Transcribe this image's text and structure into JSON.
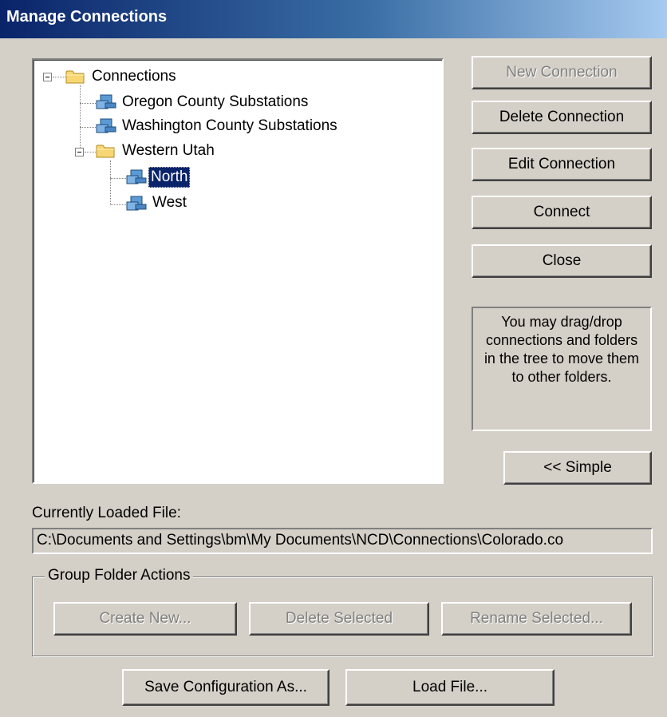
{
  "window": {
    "title": "Manage Connections"
  },
  "tree": {
    "root": {
      "label": "Connections",
      "icon": "folder-icon"
    },
    "items": [
      {
        "label": "Oregon County Substations",
        "icon": "network-connection-icon"
      },
      {
        "label": "Washington County Substations",
        "icon": "network-connection-icon"
      },
      {
        "label": "Western Utah",
        "icon": "folder-icon"
      },
      {
        "label": "North",
        "icon": "network-connection-icon",
        "selected": true
      },
      {
        "label": "West",
        "icon": "network-connection-icon"
      }
    ]
  },
  "buttons": {
    "new_connection": "New Connection",
    "delete_connection": "Delete Connection",
    "edit_connection": "Edit Connection",
    "connect": "Connect",
    "close": "Close",
    "simple": "<< Simple",
    "save_config": "Save Configuration As...",
    "load_file": "Load File..."
  },
  "hint": "You may drag/drop connections and folders in the tree to move them to other folders.",
  "file": {
    "label": "Currently Loaded File:",
    "path": "C:\\Documents and Settings\\bm\\My Documents\\NCD\\Connections\\Colorado.co"
  },
  "group": {
    "title": "Group Folder Actions",
    "create_new": "Create New...",
    "delete_selected": "Delete Selected",
    "rename_selected": "Rename Selected..."
  },
  "colors": {
    "title_start": "#0a246a",
    "title_end": "#a6caf0",
    "face": "#d4d0c8",
    "selection": "#0a246a"
  }
}
